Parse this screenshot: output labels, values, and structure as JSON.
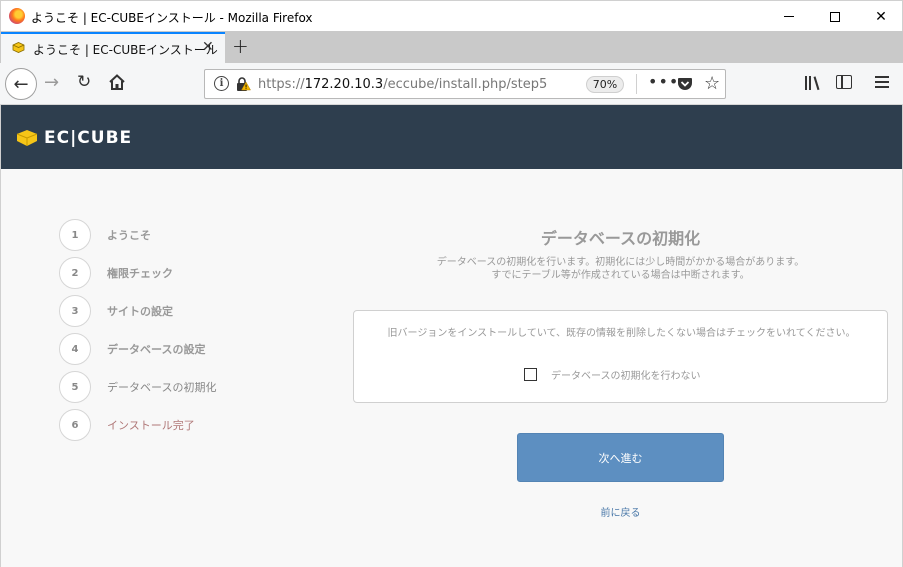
{
  "window": {
    "title": "ようこそ | EC-CUBEインストール - Mozilla Firefox",
    "minimize_glyph": "",
    "close_glyph": "✕"
  },
  "tab": {
    "title": "ようこそ | EC-CUBEインストール",
    "close_glyph": "✕",
    "new_tab_glyph": "+"
  },
  "nav": {
    "back_glyph": "←",
    "forward_glyph": "→",
    "reload_glyph": "↻",
    "url_scheme": "https://",
    "url_host": "172.20.10.3",
    "url_path": "/eccube/install.php/step5",
    "zoom": "70%",
    "more_glyph": "•••",
    "star_glyph": "☆",
    "info_glyph": "i"
  },
  "header": {
    "brand": "EC|CUBE"
  },
  "steps": [
    {
      "num": "1",
      "label": "ようこそ",
      "state": "done"
    },
    {
      "num": "2",
      "label": "権限チェック",
      "state": "done"
    },
    {
      "num": "3",
      "label": "サイトの設定",
      "state": "done"
    },
    {
      "num": "4",
      "label": "データベースの設定",
      "state": "done"
    },
    {
      "num": "5",
      "label": "データベースの初期化",
      "state": "current"
    },
    {
      "num": "6",
      "label": "インストール完了",
      "state": "upcoming"
    }
  ],
  "main": {
    "title": "データベースの初期化",
    "desc_line1": "データベースの初期化を行います。初期化には少し時間がかかる場合があります。",
    "desc_line2": "すでにテーブル等が作成されている場合は中断されます。",
    "panel_note": "旧バージョンをインストールしていて、既存の情報を削除したくない場合はチェックをいれてください。",
    "checkbox_label": "データベースの初期化を行わない",
    "checkbox_checked": false,
    "next_button": "次へ進む",
    "back_link": "前に戻る"
  },
  "colors": {
    "header_bg": "#2e3e4e",
    "button_bg": "#5d8fc1",
    "tab_accent": "#0a84ff",
    "brand_icon": "#f5c518"
  }
}
